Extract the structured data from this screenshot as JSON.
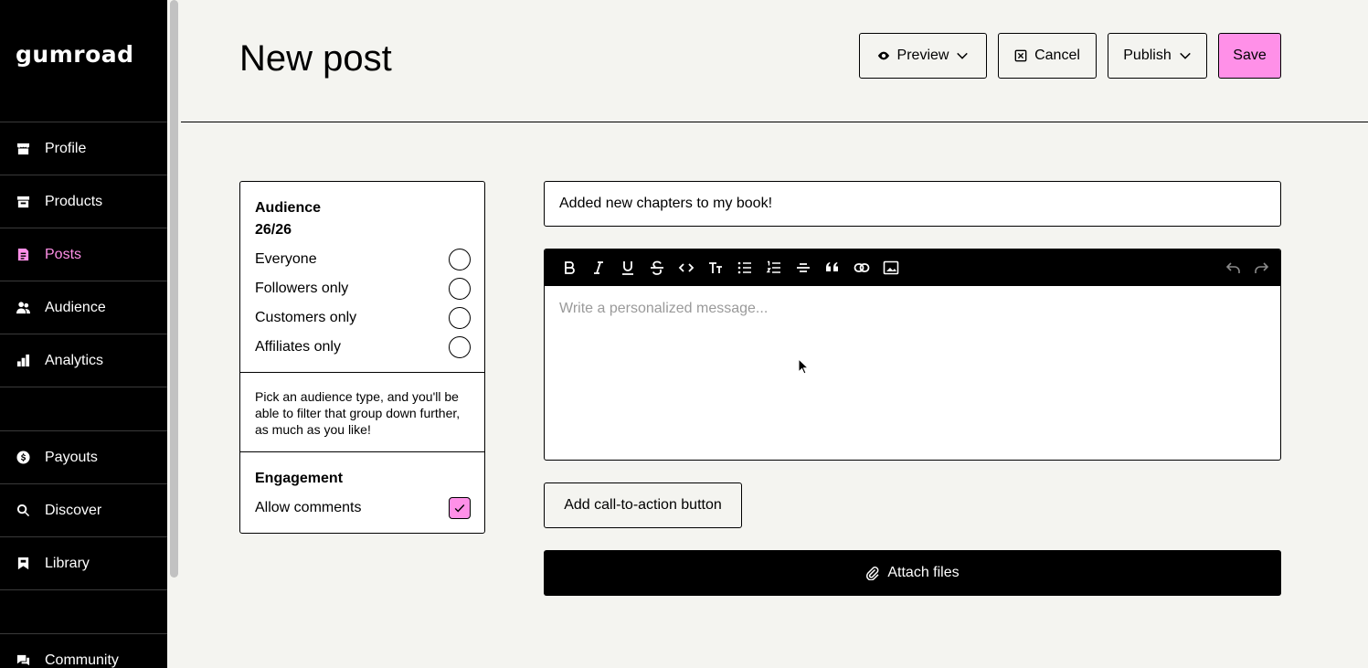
{
  "brand": {
    "logo": "gumroad",
    "accent": "#ff90e8"
  },
  "sidebar": {
    "items": [
      {
        "label": "Profile",
        "icon": "shop-icon"
      },
      {
        "label": "Products",
        "icon": "archive-icon"
      },
      {
        "label": "Posts",
        "icon": "document-icon",
        "active": true
      },
      {
        "label": "Audience",
        "icon": "people-icon"
      },
      {
        "label": "Analytics",
        "icon": "bar-chart-icon"
      },
      {
        "label": "Payouts",
        "icon": "dollar-icon"
      },
      {
        "label": "Discover",
        "icon": "search-icon"
      },
      {
        "label": "Library",
        "icon": "bookmark-icon"
      },
      {
        "label": "Community",
        "icon": "chat-icon"
      }
    ]
  },
  "header": {
    "title": "New post",
    "preview_label": "Preview",
    "cancel_label": "Cancel",
    "publish_label": "Publish",
    "save_label": "Save"
  },
  "audience": {
    "title": "Audience",
    "count": "26/26",
    "options": [
      "Everyone",
      "Followers only",
      "Customers only",
      "Affiliates only"
    ],
    "hint": "Pick an audience type, and you'll be able to filter that group down further, as much as you like!",
    "engagement_title": "Engagement",
    "allow_comments_label": "Allow comments",
    "allow_comments_checked": true
  },
  "editor": {
    "title_value": "Added new chapters to my book!",
    "body_placeholder": "Write a personalized message...",
    "toolbar": [
      "bold-icon",
      "italic-icon",
      "underline-icon",
      "strikethrough-icon",
      "code-icon",
      "text-size-icon",
      "bullet-list-icon",
      "numbered-list-icon",
      "horizontal-rule-icon",
      "quote-icon",
      "link-icon",
      "image-icon"
    ],
    "toolbar_right": [
      "undo-icon",
      "redo-icon"
    ]
  },
  "actions": {
    "cta_label": "Add call-to-action button",
    "attach_label": "Attach files"
  }
}
